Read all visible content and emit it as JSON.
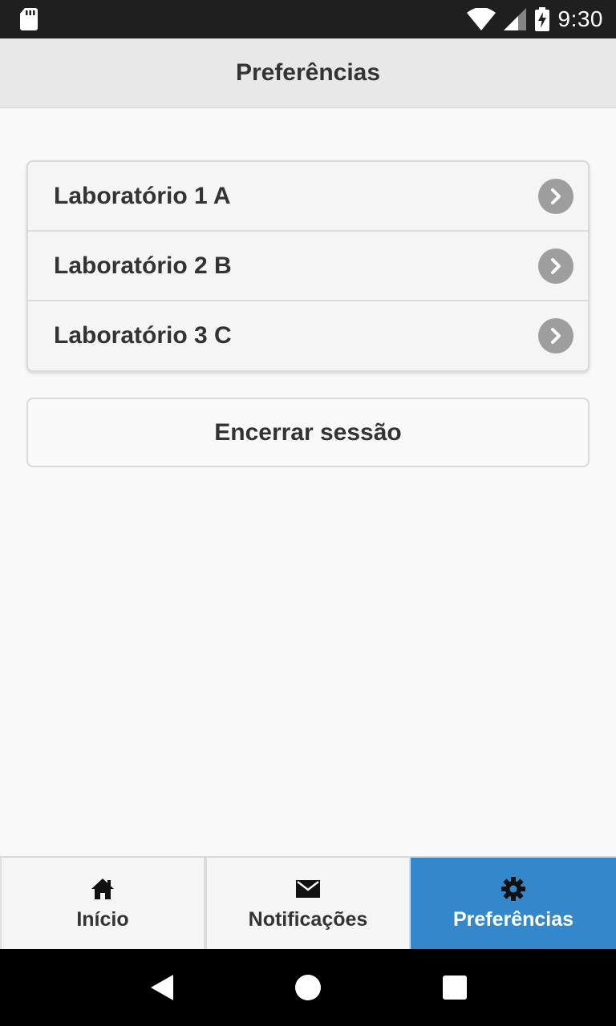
{
  "status_bar": {
    "time": "9:30",
    "icons": [
      "sd-card-icon",
      "wifi-icon",
      "signal-icon",
      "battery-charging-icon"
    ]
  },
  "header": {
    "title": "Preferências"
  },
  "lab_list": {
    "items": [
      {
        "label": "Laboratório 1 A",
        "icon": "chevron-right-icon"
      },
      {
        "label": "Laboratório 2 B",
        "icon": "chevron-right-icon"
      },
      {
        "label": "Laboratório 3 C",
        "icon": "chevron-right-icon"
      }
    ]
  },
  "logout": {
    "label": "Encerrar sessão"
  },
  "tabs": [
    {
      "label": "Início",
      "icon": "home-icon",
      "active": false
    },
    {
      "label": "Notificações",
      "icon": "mail-icon",
      "active": false
    },
    {
      "label": "Preferências",
      "icon": "gear-icon",
      "active": true
    }
  ],
  "colors": {
    "accent": "#3388cc",
    "header_bg": "#e8e8e8",
    "chevron_bg": "#9e9e9e",
    "status_bar_bg": "#1f1f1f"
  },
  "nav_bar": {
    "buttons": [
      "back-icon",
      "home-circle-icon",
      "recents-icon"
    ]
  }
}
